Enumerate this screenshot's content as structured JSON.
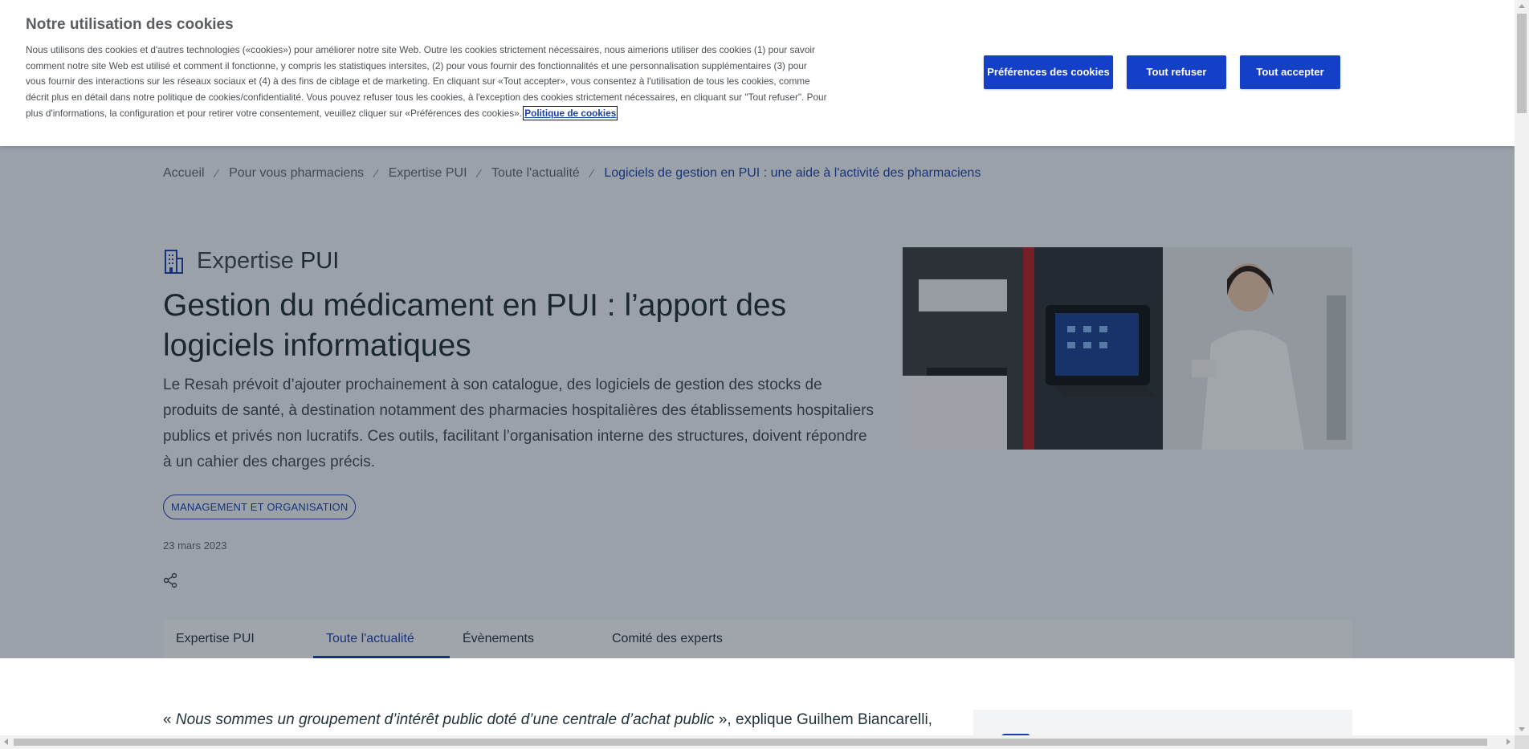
{
  "cookie_banner": {
    "title": "Notre utilisation des cookies",
    "text": "Nous utilisons des cookies et d'autres technologies («cookies») pour améliorer notre site Web. Outre les cookies strictement nécessaires, nous aimerions utiliser des cookies (1) pour savoir comment notre site Web est utilisé et comment il fonctionne, y compris les statistiques intersites, (2) pour vous fournir des fonctionnalités et une personnalisation supplémentaires (3) pour vous fournir des interactions sur les réseaux sociaux et (4) à des fins de ciblage et de marketing. En cliquant sur «Tout accepter», vous consentez à l'utilisation de tous les cookies, comme décrit plus en détail dans notre politique de cookies/confidentialité. Vous pouvez refuser tous les cookies, à l'exception des cookies strictement nécessaires, en cliquant sur \"Tout refuser\". Pour plus d'informations, la configuration et pour retirer votre consentement, veuillez cliquer sur «Préférences des cookies».",
    "policy_link": "Politique de cookies",
    "buttons": {
      "preferences": "Préférences des cookies",
      "refuse_all": "Tout refuser",
      "accept_all": "Tout accepter"
    }
  },
  "breadcrumb": {
    "separator": "⁄",
    "items": [
      "Accueil",
      "Pour vous pharmaciens",
      "Expertise PUI",
      "Toute l'actualité",
      "Logiciels de gestion en PUI : une aide à l'activité des pharmaciens"
    ]
  },
  "article": {
    "section_prefix": "Expertise",
    "section_strong": "PUI",
    "title": "Gestion du médicament en PUI : l’apport des logiciels informatiques",
    "lead": "Le Resah prévoit d’ajouter prochainement à son catalogue, des logiciels de gestion des stocks de produits de santé, à destination notamment des pharmacies hospitalières des établissements hospitaliers publics et privés non lucratifs. Ces outils, facilitant l’organisation interne des structures, doivent répondre à un cahier des charges précis.",
    "tag": "MANAGEMENT ET ORGANISATION",
    "date": "23 mars 2023"
  },
  "tabs": [
    {
      "label": "Expertise PUI",
      "active": false
    },
    {
      "label": "Toute l'actualité",
      "active": true
    },
    {
      "label": "Évènements",
      "active": false
    },
    {
      "label": "Comité des experts",
      "active": false
    }
  ],
  "body": {
    "quote_open": "« ",
    "quote_italic": "Nous sommes un groupement d’intérêt public doté d’une centrale d’achat public",
    "quote_rest": " », explique Guilhem Biancarelli,"
  },
  "colors": {
    "accent": "#1440c8",
    "link": "#1b3fa8",
    "overlay": "rgba(20,32,46,0.38)"
  },
  "icons": {
    "section": "building-icon",
    "share": "share-icon"
  }
}
